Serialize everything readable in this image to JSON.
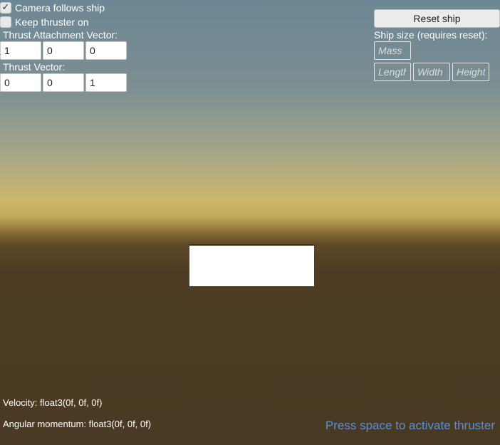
{
  "toggles": {
    "camera_follows": {
      "label": "Camera follows ship",
      "checked": true
    },
    "keep_thruster": {
      "label": "Keep thruster on",
      "checked": false
    }
  },
  "thrust_attachment": {
    "label": "Thrust Attachment Vector:",
    "x": "1",
    "y": "0",
    "z": "0"
  },
  "thrust_vector": {
    "label": "Thrust Vector:",
    "x": "0",
    "y": "0",
    "z": "1"
  },
  "reset_button": "Reset ship",
  "ship_size": {
    "label": "Ship size (requires reset):",
    "mass_placeholder": "Mass",
    "length_placeholder": "Length",
    "width_placeholder": "Width",
    "height_placeholder": "Height"
  },
  "stats": {
    "velocity": "Velocity: float3(0f, 0f, 0f)",
    "angular_momentum": "Angular momentum: float3(0f, 0f, 0f)"
  },
  "hint": "Press space to activate thruster",
  "colors": {
    "hint": "#5b8fd3",
    "ship": "#ffffff",
    "ground": "#4a3a23"
  }
}
